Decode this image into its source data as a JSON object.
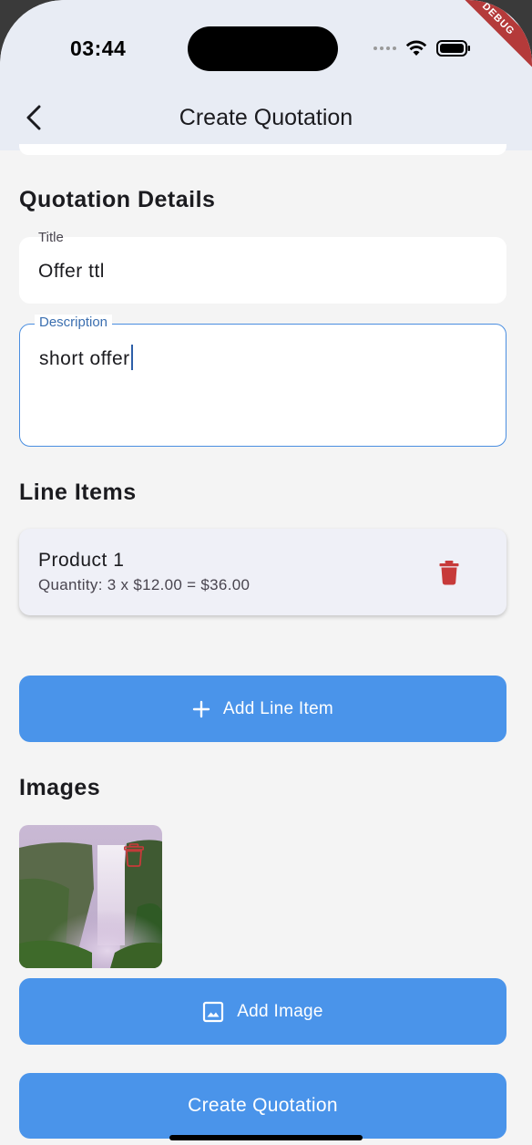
{
  "status_bar": {
    "time": "03:44",
    "debug_banner": "DEBUG"
  },
  "app_bar": {
    "title": "Create Quotation",
    "back_icon": "chevron-left-icon"
  },
  "quotation_details": {
    "heading": "Quotation Details",
    "title_field": {
      "label": "Title",
      "value": "Offer ttl"
    },
    "description_field": {
      "label": "Description",
      "value": "short offer"
    }
  },
  "line_items": {
    "heading": "Line Items",
    "items": [
      {
        "name": "Product 1",
        "detail": "Quantity: 3 x $12.00 = $36.00",
        "delete_icon": "trash-icon"
      }
    ],
    "add_button": {
      "label": "Add Line Item",
      "icon": "plus-icon"
    }
  },
  "images": {
    "heading": "Images",
    "items": [
      {
        "subject": "waterfall-photo",
        "delete_icon": "trash-icon"
      }
    ],
    "add_button": {
      "label": "Add Image",
      "icon": "image-icon"
    }
  },
  "submit_button": {
    "label": "Create Quotation"
  },
  "colors": {
    "accent": "#4a94ea",
    "delete": "#c73a3a",
    "appbar": "#e8ecf4",
    "background": "#f4f4f4",
    "focus_border": "#4a8ee0"
  }
}
